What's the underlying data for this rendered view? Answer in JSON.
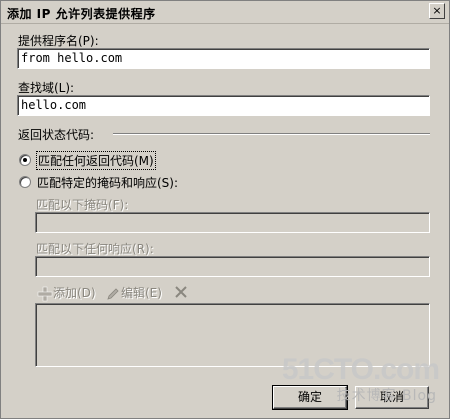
{
  "window": {
    "title": "添加 IP 允许列表提供程序",
    "close_glyph": "×"
  },
  "fields": {
    "provider_name": {
      "label": "提供程序名(P):",
      "value": "from hello.com"
    },
    "lookup_domain": {
      "label": "查找域(L):",
      "value": "hello.com"
    }
  },
  "return_code": {
    "group_label": "返回状态代码:",
    "options": [
      {
        "label": "匹配任何返回代码(M)",
        "selected": true
      },
      {
        "label": "匹配特定的掩码和响应(S):",
        "selected": false
      }
    ],
    "mask_label": "匹配以下掩码(F):",
    "mask_value": "",
    "response_label": "匹配以下任何响应(R):",
    "response_value": ""
  },
  "toolbar": {
    "add_label": "添加(D)",
    "edit_label": "编辑(E)"
  },
  "buttons": {
    "ok_label": "确定",
    "cancel_label": "取消"
  },
  "watermark": {
    "line1": "51CTO.com",
    "line2": "技术博客  Blog"
  }
}
